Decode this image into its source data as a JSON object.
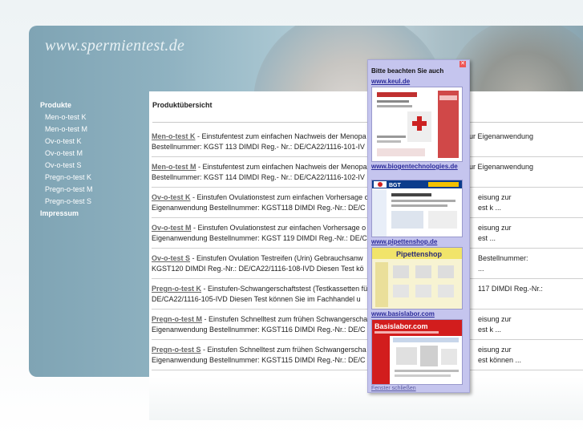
{
  "site": {
    "logo": "www.spermientest.de"
  },
  "nav": {
    "head": "Produkte",
    "items": [
      "Men-o-test K",
      "Men-o-test M",
      "Ov-o-test K",
      "Ov-o-test M",
      "Ov-o-test S",
      "Pregn-o-test K",
      "Pregn-o-test M",
      "Pregn-o-test S"
    ],
    "impressum": "Impressum"
  },
  "main": {
    "title": "Produktübersicht",
    "products": [
      {
        "name": "Men-o-test K",
        "l1": " - Einstufentest zum einfachen Nachweis der Menopa",
        "l1r": "ur Eigenanwendung",
        "l2": "Bestellnummer: KGST 113 DIMDI Reg.- Nr.: DE/CA22/1116-101-IV"
      },
      {
        "name": "Men-o-test M",
        "l1": " - Einstufentest zum einfachen Nachweis der Menopa",
        "l1r": "ur Eigenanwendung",
        "l2": "Bestellnummer: KGST 114 DIMDI Reg.- Nr.: DE/CA22/1116-102-IV"
      },
      {
        "name": "Ov-o-test K",
        "l1": " - Einstufen Ovulationstest zum einfachen Vorhersage o",
        "l1r": "eisung zur",
        "l2": "Eigenanwendung Bestellnummer: KGST118 DIMDI Reg.-Nr.: DE/C",
        "l2r": "est k ..."
      },
      {
        "name": "Ov-o-test M",
        "l1": " - Einstufen Ovulationstest zur einfachen Vorhersage o",
        "l1r": "eisung zur",
        "l2": "Eigenanwendung Bestellnummer: KGST 119 DIMDI Reg.-Nr.: DE/C",
        "l2r": "est ..."
      },
      {
        "name": "Ov-o-test S",
        "l1": " - Einstufen Ovulation Testreifen (Urin) Gebrauchsanw",
        "l1r": "Bestellnummer:",
        "l2": "KGST120 DIMDI Reg.-Nr.: DE/CA22/1116-108-IVD Diesen Test kö",
        "l2r": "..."
      },
      {
        "name": "Pregn-o-test K",
        "l1": " - Einstufen-Schwangerschaftstest (Testkassetten fü",
        "l1r": "117 DIMDI Reg.-Nr.:",
        "l2": "DE/CA22/1116-105-IVD Diesen Test können Sie im Fachhandel u",
        "l2r": ""
      },
      {
        "name": "Pregn-o-test M",
        "l1": " - Einstufen Schnelltest zum frühen Schwangerscha",
        "l1r": "eisung zur",
        "l2": "Eigenanwendung Bestellnummer: KGST116 DIMDI Reg.-Nr.: DE/C",
        "l2r": "est k ..."
      },
      {
        "name": "Pregn-o-test S",
        "l1": " - Einstufen Schnelltest zum frühen Schwangerscha",
        "l1r": "eisung zur",
        "l2": "Eigenanwendung Bestellnummer: KGST115 DIMDI Reg.-Nr.: DE/C",
        "l2r": "est können ..."
      }
    ]
  },
  "popup": {
    "title": "Bitte beachten Sie auch",
    "links": [
      "www.keul.de",
      "www.biogentechnologies.de",
      "www.pipettenshop.de",
      "www.basislabor.com"
    ],
    "banner_bgt": "BGT",
    "banner_pipetten": "Pipettenshop",
    "banner_basis": "Basislabor.com",
    "footer": "Fenster schließen"
  },
  "colors": {
    "popup_bg": "#c5c5ee",
    "link": "#2a2a99",
    "panel": "#8fb2c1"
  }
}
